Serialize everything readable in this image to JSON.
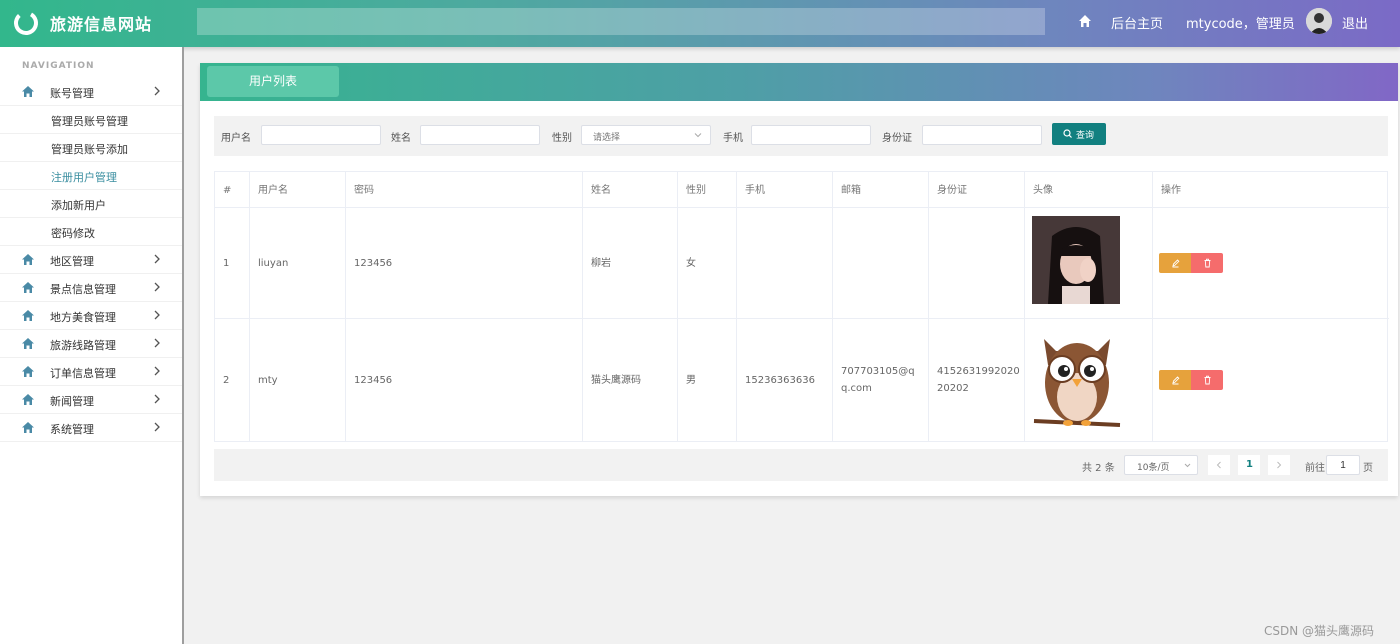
{
  "header": {
    "site_title": "旅游信息网站",
    "home_label": "后台主页",
    "user_label": "mtycode，管理员",
    "logout_label": "退出"
  },
  "sidebar": {
    "nav_title": "NAVIGATION",
    "menus": [
      {
        "label": "账号管理",
        "expanded": true,
        "children": [
          "管理员账号管理",
          "管理员账号添加",
          "注册用户管理",
          "添加新用户",
          "密码修改"
        ]
      },
      {
        "label": "地区管理"
      },
      {
        "label": "景点信息管理"
      },
      {
        "label": "地方美食管理"
      },
      {
        "label": "旅游线路管理"
      },
      {
        "label": "订单信息管理"
      },
      {
        "label": "新闻管理"
      },
      {
        "label": "系统管理"
      }
    ],
    "active_child": "注册用户管理"
  },
  "page": {
    "tab_label": "用户列表"
  },
  "filters": {
    "username_label": "用户名",
    "username_value": "",
    "name_label": "姓名",
    "name_value": "",
    "gender_label": "性别",
    "gender_placeholder": "请选择",
    "phone_label": "手机",
    "phone_value": "",
    "idcard_label": "身份证",
    "idcard_value": "",
    "query_label": "查询"
  },
  "table": {
    "columns": [
      "#",
      "用户名",
      "密码",
      "姓名",
      "性别",
      "手机",
      "邮箱",
      "身份证",
      "头像",
      "操作"
    ],
    "rows": [
      {
        "index": "1",
        "username": "liuyan",
        "password": "123456",
        "name": "柳岩",
        "gender": "女",
        "phone": "",
        "email": "",
        "idcard": "",
        "avatar": "photo-avatar"
      },
      {
        "index": "2",
        "username": "mty",
        "password": "123456",
        "name": "猫头鹰源码",
        "gender": "男",
        "phone": "15236363636",
        "email_line1": "707703105@q",
        "email_line2": "q.com",
        "idcard_line1": "4152631992020",
        "idcard_line2": "20202",
        "avatar": "owl-avatar"
      }
    ]
  },
  "pager": {
    "total_text": "共 2 条",
    "page_size": "10条/页",
    "current_page": "1",
    "goto_label": "前往",
    "goto_value": "1",
    "page_unit": "页"
  },
  "watermark": "CSDN @猫头鹰源码",
  "colors": {
    "accent": "#128080",
    "edit": "#e6a23c",
    "delete": "#f56c6c"
  }
}
